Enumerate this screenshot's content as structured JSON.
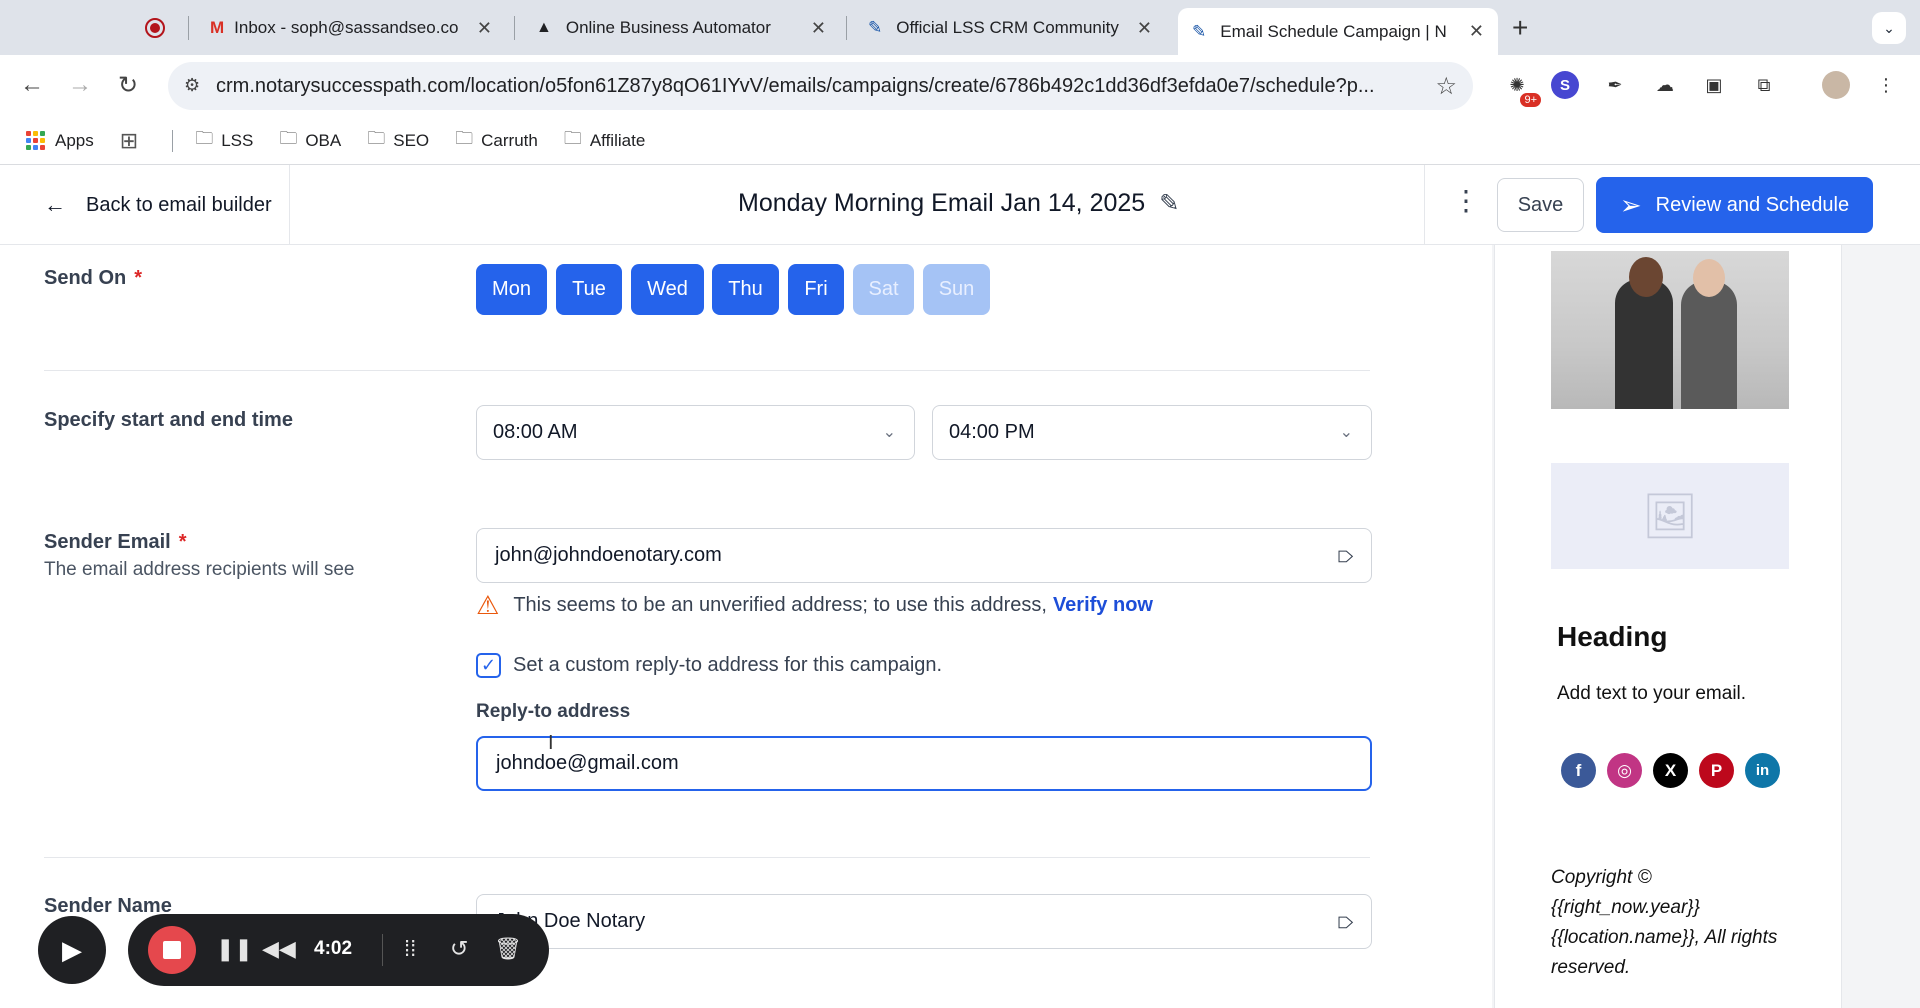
{
  "browser": {
    "tabs": [
      {
        "label": "Inbox - soph@sassandseo.co",
        "icon": "gmail-icon"
      },
      {
        "label": "Online Business Automator",
        "icon": "triangle-icon"
      },
      {
        "label": "Official LSS CRM Community",
        "icon": "feather-icon"
      },
      {
        "label": "Email Schedule Campaign | N",
        "icon": "feather-icon",
        "active": true
      }
    ],
    "close_glyph": "✕",
    "new_tab": "+",
    "url": "crm.notarysuccesspath.com/location/o5fon61Z87y8qO61IYvV/emails/campaigns/create/6786b492c1dd36df3efda0e7/schedule?p...",
    "extension_badge": "9+",
    "extension_s": "S",
    "bookmarks": [
      {
        "label": "Apps",
        "icon": "apps-grid-icon"
      },
      {
        "label": "LSS",
        "icon": "folder-icon"
      },
      {
        "label": "OBA",
        "icon": "folder-icon"
      },
      {
        "label": "SEO",
        "icon": "folder-icon"
      },
      {
        "label": "Carruth",
        "icon": "folder-icon"
      },
      {
        "label": "Affiliate",
        "icon": "folder-icon"
      }
    ]
  },
  "header": {
    "back_label": "Back to email builder",
    "title": "Monday Morning Email Jan 14, 2025",
    "save_label": "Save",
    "review_label": "Review and Schedule"
  },
  "form": {
    "send_on": {
      "label": "Send On",
      "required_mark": "*",
      "days": [
        {
          "label": "Mon",
          "selected": true
        },
        {
          "label": "Tue",
          "selected": true
        },
        {
          "label": "Wed",
          "selected": true
        },
        {
          "label": "Thu",
          "selected": true
        },
        {
          "label": "Fri",
          "selected": true
        },
        {
          "label": "Sat",
          "selected": false
        },
        {
          "label": "Sun",
          "selected": false
        }
      ]
    },
    "time": {
      "label": "Specify start and end time",
      "start": "08:00 AM",
      "end": "04:00 PM"
    },
    "sender_email": {
      "label": "Sender Email",
      "required_mark": "*",
      "help": "The email address recipients will see",
      "value": "john@johndoenotary.com",
      "warning": "This seems to be an unverified address; to use this address,",
      "verify_link": "Verify now"
    },
    "reply_to": {
      "checkbox_label": "Set a custom reply-to address for this campaign.",
      "checked": true,
      "label": "Reply-to address",
      "value": "johndoe@gmail.com"
    },
    "sender_name": {
      "label": "Sender Name",
      "value": "John Doe Notary"
    }
  },
  "preview": {
    "heading": "Heading",
    "text": "Add text to your email.",
    "socials": [
      {
        "name": "facebook",
        "glyph": "f",
        "color": "#3b5998"
      },
      {
        "name": "instagram",
        "glyph": "◎",
        "color": "#c13584"
      },
      {
        "name": "x",
        "glyph": "X",
        "color": "#000000"
      },
      {
        "name": "pinterest",
        "glyph": "P",
        "color": "#bd081c"
      },
      {
        "name": "linkedin",
        "glyph": "in",
        "color": "#0e76a8"
      }
    ],
    "copyright": "Copyright © {{right_now.year}} {{location.name}}, All rights reserved."
  },
  "recorder": {
    "time": "4:02"
  },
  "colors": {
    "accent": "#2563eb",
    "accent_disabled": "#a5c3f5",
    "warning": "#ea580c",
    "required": "#dc2626"
  }
}
